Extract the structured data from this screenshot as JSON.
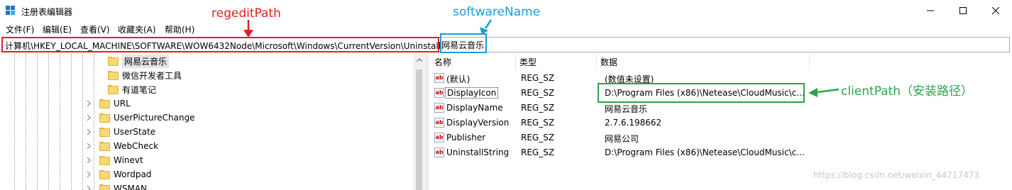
{
  "window": {
    "title": "注册表编辑器",
    "icon": "regedit-icon"
  },
  "menu": [
    "文件(F)",
    "编辑(E)",
    "查看(V)",
    "收藏夹(A)",
    "帮助(H)"
  ],
  "address": {
    "path": "计算机\\HKEY_LOCAL_MACHINE\\SOFTWARE\\WOW6432Node\\Microsoft\\Windows\\CurrentVersion\\Uninstall\\",
    "leaf": "网易云音乐"
  },
  "tree": {
    "selected": "网易云音乐",
    "children": [
      "微信开发者工具",
      "有道笔记"
    ],
    "siblings": [
      "URL",
      "UserPictureChange",
      "UserState",
      "WebCheck",
      "Winevt",
      "Wordpad",
      "WSMAN"
    ]
  },
  "values_table": {
    "columns": [
      "名称",
      "类型",
      "数据"
    ],
    "rows": [
      {
        "name": "(默认)",
        "type": "REG_SZ",
        "data": "(数值未设置)"
      },
      {
        "name": "DisplayIcon",
        "type": "REG_SZ",
        "data": "D:\\Program Files (x86)\\Netease\\CloudMusic\\c..."
      },
      {
        "name": "DisplayName",
        "type": "REG_SZ",
        "data": "网易云音乐"
      },
      {
        "name": "DisplayVersion",
        "type": "REG_SZ",
        "data": "2.7.6.198662"
      },
      {
        "name": "Publisher",
        "type": "REG_SZ",
        "data": "网易公司"
      },
      {
        "name": "UninstallString",
        "type": "REG_SZ",
        "data": "D:\\Program Files (x86)\\Netease\\CloudMusic\\c..."
      }
    ],
    "value_icon": "ab"
  },
  "annotations": {
    "regedit_path": "regeditPath",
    "software_name": "softwareName",
    "client_path": "clientPath（安装路径）"
  },
  "colors": {
    "red": "#e02020",
    "blue": "#1a9be0",
    "green": "#2aa34a"
  },
  "watermark": "https://blog.csdn.net/weixin_44717473"
}
